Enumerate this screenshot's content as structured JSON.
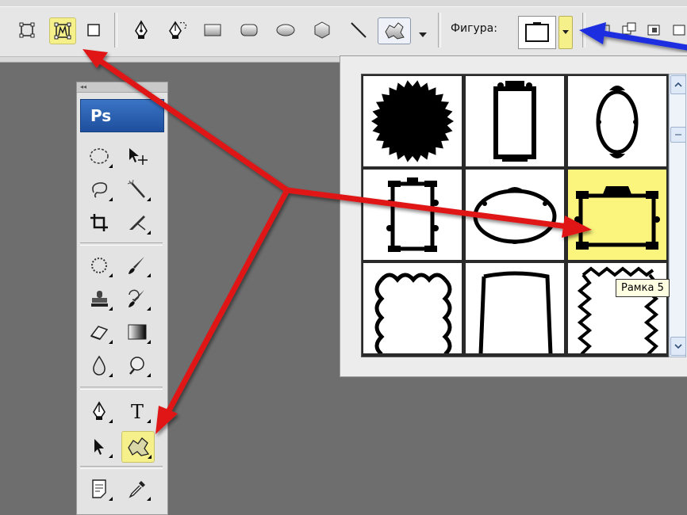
{
  "options_bar": {
    "shape_label": "Фигура:"
  },
  "toolbox": {
    "logo": "Ps",
    "grip": "◂◂"
  },
  "shape_picker": {
    "tooltip": "Рамка 5",
    "selected_index": 5
  },
  "colors": {
    "highlight": "#f6f08a",
    "red_arrow": "#e01818",
    "blue_arrow": "#1a2ee0"
  }
}
